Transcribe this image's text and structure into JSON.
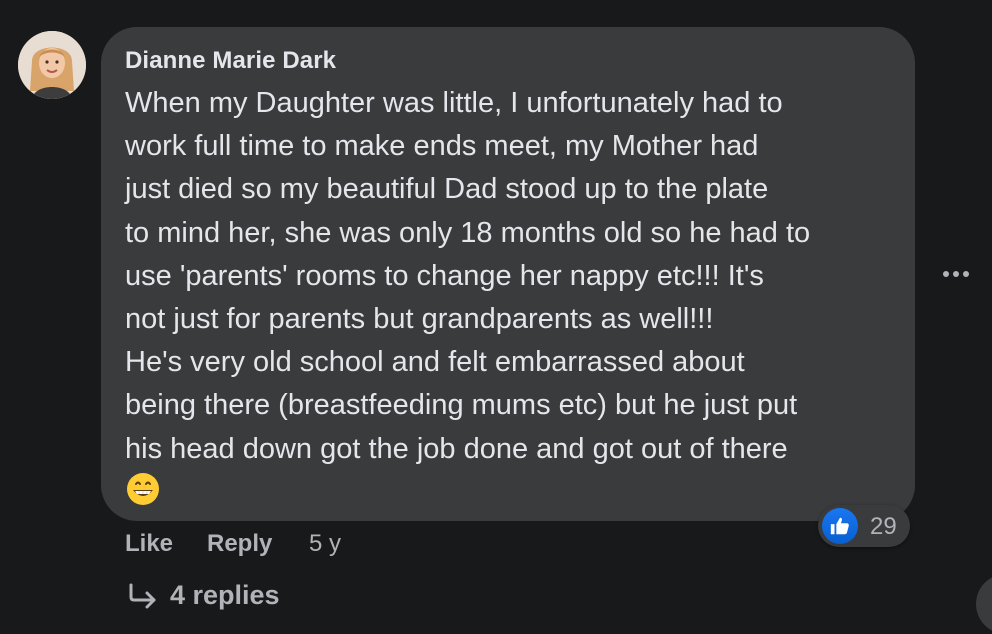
{
  "comment": {
    "author": "Dianne Marie Dark",
    "lines": [
      "When my Daughter was little, I unfortunately had to",
      "work full time to make ends meet, my Mother had",
      "just died so my beautiful Dad stood up to the plate",
      "to mind her, she was only 18 months old so he had to",
      "use 'parents' rooms to change her nappy etc!!! It's",
      "not just for parents but grandparents as well!!!",
      "He's very old school and felt embarrassed about",
      "being there (breastfeeding mums etc) but he just put",
      "his head down got the job done and got out of there"
    ],
    "emoji": "grinning-face-emoji"
  },
  "reactions": {
    "icon": "thumbs-up-icon",
    "count": "29",
    "color": "#1877f2"
  },
  "actions": {
    "like": "Like",
    "reply": "Reply",
    "time": "5 y"
  },
  "replies": {
    "label": "4 replies",
    "icon": "reply-arrow-icon"
  },
  "colors": {
    "background": "#18191a",
    "bubble": "#3a3b3c",
    "text": "#e4e6eb",
    "secondary": "#b0b3b8"
  }
}
